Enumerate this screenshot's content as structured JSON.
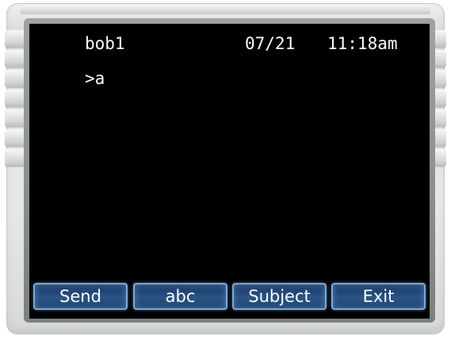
{
  "status": {
    "username": "bob1",
    "date": "07/21",
    "time": "11:18am"
  },
  "message": {
    "line": ">a"
  },
  "softkeys": {
    "send": "Send",
    "abc": "abc",
    "subject": "Subject",
    "exit": "Exit"
  },
  "colors": {
    "screen_background": "#000000",
    "text": "#ffffff",
    "softkey_fill": "#224777",
    "softkey_glow": "#7aa8d6",
    "bezel": "#dcdfdd"
  }
}
